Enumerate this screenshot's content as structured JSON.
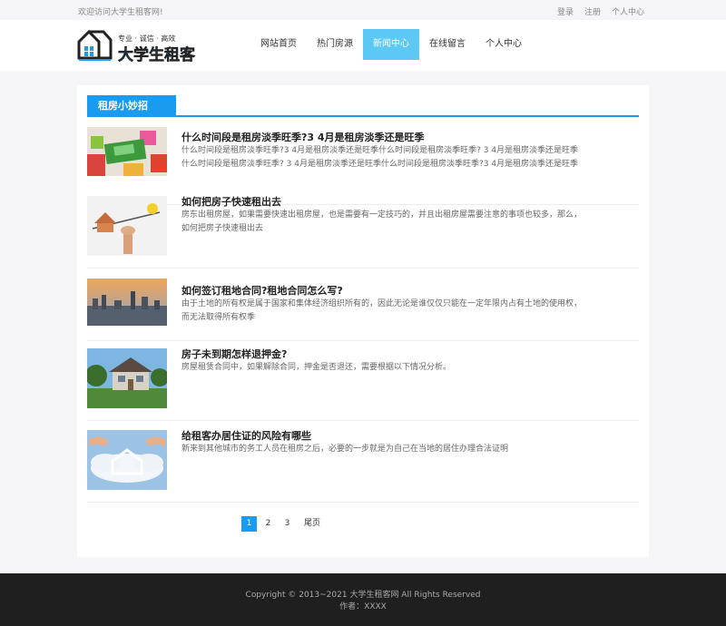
{
  "topbar": {
    "welcome": "欢迎访问大学生租客网!",
    "links": [
      "登录",
      "注册",
      "个人中心"
    ]
  },
  "logo": {
    "slogan": "专业 · 诚信 · 高效",
    "name": "大学生租客"
  },
  "nav": [
    "网站首页",
    "热门房源",
    "新闻中心",
    "在线留言",
    "个人中心"
  ],
  "nav_active": "新闻中心",
  "section_title": "租房小妙招",
  "articles": [
    {
      "title": "什么时间段是租房淡季旺季?3 4月是租房淡季还是旺季",
      "desc": "什么时间段是租房淡季旺季?3 4月是租房淡季还是旺季什么时间段是租房淡季旺季? 3 4月是租房淡季还是旺季什么时间段是租房淡季旺季? 3 4月是租房淡季还是旺季什么时间段是租房淡季旺季?3 4月是租房淡季还是旺季"
    },
    {
      "title": "如何把房子快速租出去",
      "desc": "房东出租房屋，如果需要快速出租房屋，也是需要有一定技巧的，并且出租房屋需要注意的事项也较多，那么，如何把房子快速租出去"
    },
    {
      "title": "如何签订租地合同?租地合同怎么写?",
      "desc": "由于土地的所有权是属于国家和集体经济组织所有的，因此无论是谁仅仅只能在一定年限内占有土地的使用权，而无法取得所有权季"
    },
    {
      "title": "房子未到期怎样退押金?",
      "desc": "房屋租赁合同中，如果解除合同，押金是否退还，需要根据以下情况分析。"
    },
    {
      "title": "给租客办居住证的风险有哪些",
      "desc": "新来到其他城市的务工人员在租房之后，必要的一步就是为自己在当地的居住办理合法证明"
    }
  ],
  "pagination": {
    "pages": [
      "1",
      "2",
      "3"
    ],
    "current": "1",
    "last_label": "尾页"
  },
  "footer": {
    "copyright": "Copyright © 2013~2021 大学生租客网 All Rights Reserved",
    "author": "作者：XXXX"
  },
  "colors": {
    "accent": "#1a9bef",
    "nav_active": "#5cc9f5",
    "footer_bg": "#1f1f1f"
  }
}
